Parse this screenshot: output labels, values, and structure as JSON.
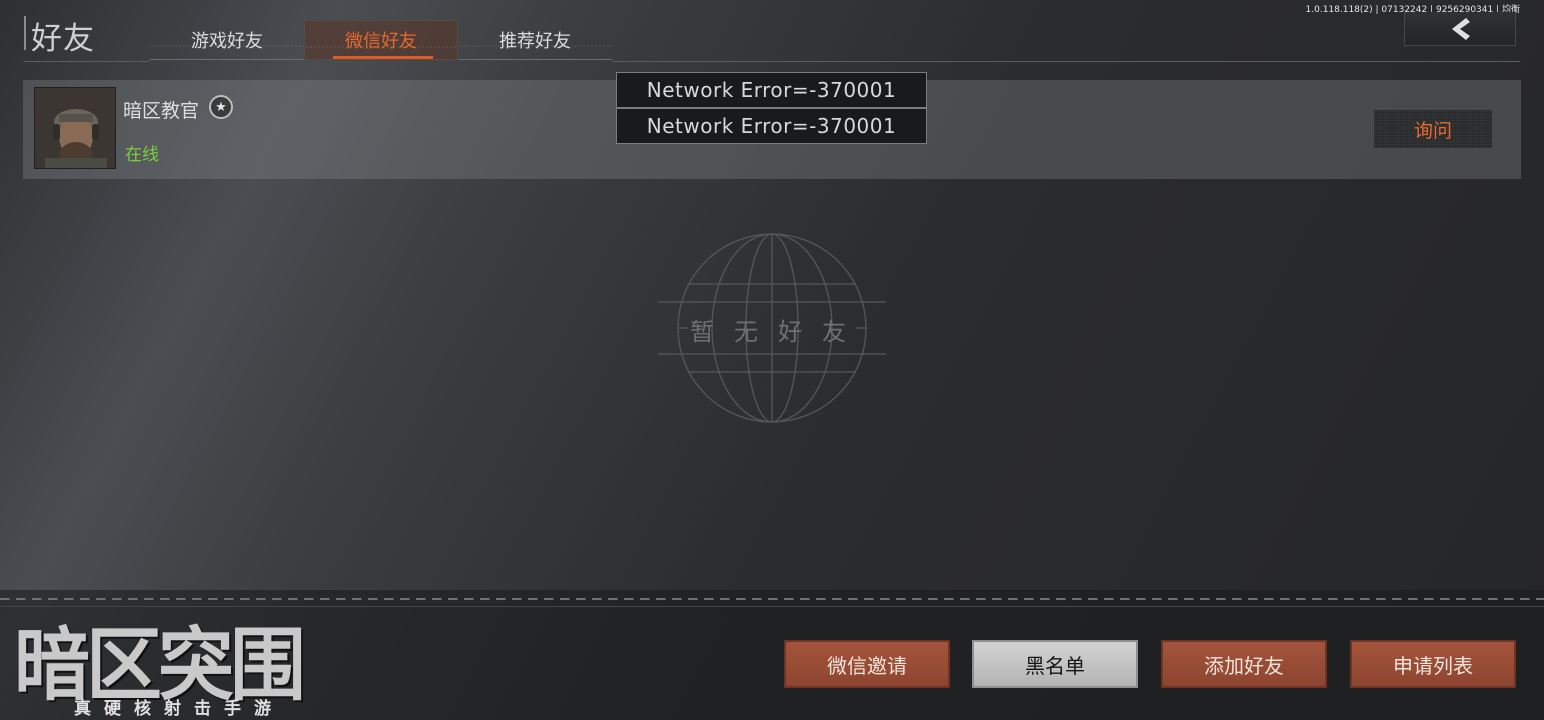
{
  "version_text": "1.0.118.118(2) | 07132242 | 9256290341 | 均衡",
  "header": {
    "title": "好友",
    "tabs": [
      {
        "label": "游戏好友",
        "active": false
      },
      {
        "label": "微信好友",
        "active": true
      },
      {
        "label": "推荐好友",
        "active": false
      }
    ],
    "back_icon": "chevron-left-icon"
  },
  "friends": [
    {
      "name": "暗区教官",
      "status": "在线",
      "badge_icon": "star-badge-icon",
      "action_label": "询问"
    }
  ],
  "errors": [
    "Network  Error=-370001",
    "Network  Error=-370001"
  ],
  "empty_state": {
    "text": "暂无好友"
  },
  "logo": {
    "main": "暗区突围",
    "sub": "真硬核射击手游"
  },
  "bottom_buttons": [
    {
      "label": "微信邀请",
      "style": "orange"
    },
    {
      "label": "黑名单",
      "style": "grey"
    },
    {
      "label": "添加好友",
      "style": "orange"
    },
    {
      "label": "申请列表",
      "style": "orange"
    }
  ],
  "colors": {
    "accent": "#e8682f",
    "button_orange": "#9a4d35",
    "online_green": "#7ccf3a"
  }
}
